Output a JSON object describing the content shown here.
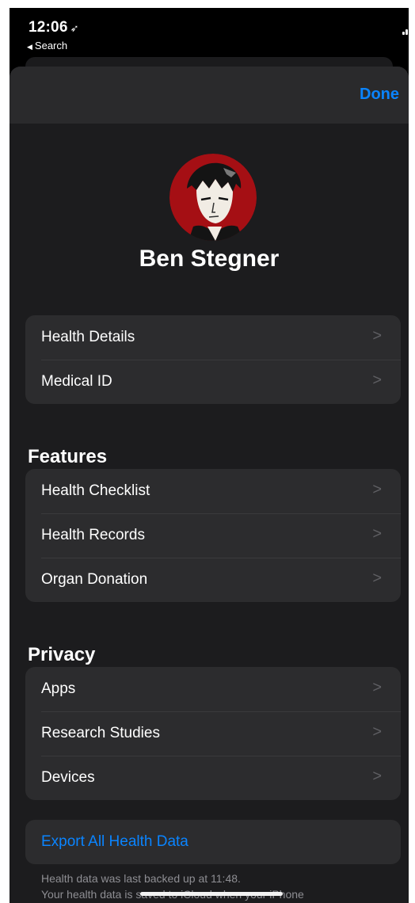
{
  "status_bar": {
    "time": "12:06",
    "location_icon": "location-arrow-icon",
    "back_app": "Search",
    "back_icon": "back-triangle-icon",
    "signal_icon": "cellular-signal-icon",
    "wifi_icon": "wifi-icon",
    "battery_icon": "battery-icon"
  },
  "nav": {
    "done_label": "Done",
    "accent_color": "#0a84ff"
  },
  "profile": {
    "name": "Ben Stegner",
    "avatar_icon": "profile-avatar",
    "avatar_bg": "#a50f14"
  },
  "profile_items": [
    {
      "label": "Health Details"
    },
    {
      "label": "Medical ID"
    }
  ],
  "features": {
    "title": "Features",
    "items": [
      {
        "label": "Health Checklist"
      },
      {
        "label": "Health Records"
      },
      {
        "label": "Organ Donation"
      }
    ]
  },
  "privacy": {
    "title": "Privacy",
    "items": [
      {
        "label": "Apps"
      },
      {
        "label": "Research Studies"
      },
      {
        "label": "Devices"
      }
    ]
  },
  "export": {
    "label": "Export All Health Data"
  },
  "footer": {
    "line1": "Health data was last backed up at 11:48.",
    "line2": "Your health data is saved to iCloud when your iPhone"
  }
}
